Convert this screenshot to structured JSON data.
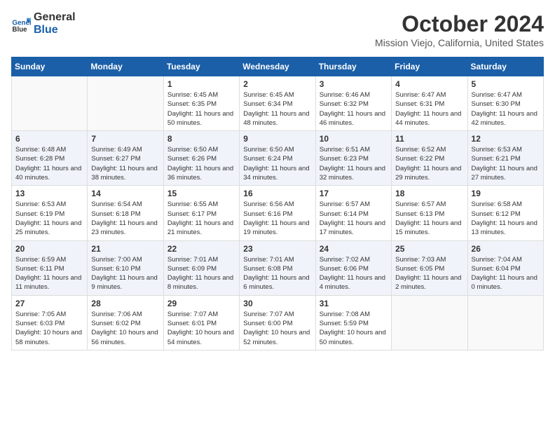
{
  "logo": {
    "line1": "General",
    "line2": "Blue"
  },
  "title": "October 2024",
  "location": "Mission Viejo, California, United States",
  "days_of_week": [
    "Sunday",
    "Monday",
    "Tuesday",
    "Wednesday",
    "Thursday",
    "Friday",
    "Saturday"
  ],
  "weeks": [
    [
      {
        "day": "",
        "content": ""
      },
      {
        "day": "",
        "content": ""
      },
      {
        "day": "1",
        "content": "Sunrise: 6:45 AM\nSunset: 6:35 PM\nDaylight: 11 hours and 50 minutes."
      },
      {
        "day": "2",
        "content": "Sunrise: 6:45 AM\nSunset: 6:34 PM\nDaylight: 11 hours and 48 minutes."
      },
      {
        "day": "3",
        "content": "Sunrise: 6:46 AM\nSunset: 6:32 PM\nDaylight: 11 hours and 46 minutes."
      },
      {
        "day": "4",
        "content": "Sunrise: 6:47 AM\nSunset: 6:31 PM\nDaylight: 11 hours and 44 minutes."
      },
      {
        "day": "5",
        "content": "Sunrise: 6:47 AM\nSunset: 6:30 PM\nDaylight: 11 hours and 42 minutes."
      }
    ],
    [
      {
        "day": "6",
        "content": "Sunrise: 6:48 AM\nSunset: 6:28 PM\nDaylight: 11 hours and 40 minutes."
      },
      {
        "day": "7",
        "content": "Sunrise: 6:49 AM\nSunset: 6:27 PM\nDaylight: 11 hours and 38 minutes."
      },
      {
        "day": "8",
        "content": "Sunrise: 6:50 AM\nSunset: 6:26 PM\nDaylight: 11 hours and 36 minutes."
      },
      {
        "day": "9",
        "content": "Sunrise: 6:50 AM\nSunset: 6:24 PM\nDaylight: 11 hours and 34 minutes."
      },
      {
        "day": "10",
        "content": "Sunrise: 6:51 AM\nSunset: 6:23 PM\nDaylight: 11 hours and 32 minutes."
      },
      {
        "day": "11",
        "content": "Sunrise: 6:52 AM\nSunset: 6:22 PM\nDaylight: 11 hours and 29 minutes."
      },
      {
        "day": "12",
        "content": "Sunrise: 6:53 AM\nSunset: 6:21 PM\nDaylight: 11 hours and 27 minutes."
      }
    ],
    [
      {
        "day": "13",
        "content": "Sunrise: 6:53 AM\nSunset: 6:19 PM\nDaylight: 11 hours and 25 minutes."
      },
      {
        "day": "14",
        "content": "Sunrise: 6:54 AM\nSunset: 6:18 PM\nDaylight: 11 hours and 23 minutes."
      },
      {
        "day": "15",
        "content": "Sunrise: 6:55 AM\nSunset: 6:17 PM\nDaylight: 11 hours and 21 minutes."
      },
      {
        "day": "16",
        "content": "Sunrise: 6:56 AM\nSunset: 6:16 PM\nDaylight: 11 hours and 19 minutes."
      },
      {
        "day": "17",
        "content": "Sunrise: 6:57 AM\nSunset: 6:14 PM\nDaylight: 11 hours and 17 minutes."
      },
      {
        "day": "18",
        "content": "Sunrise: 6:57 AM\nSunset: 6:13 PM\nDaylight: 11 hours and 15 minutes."
      },
      {
        "day": "19",
        "content": "Sunrise: 6:58 AM\nSunset: 6:12 PM\nDaylight: 11 hours and 13 minutes."
      }
    ],
    [
      {
        "day": "20",
        "content": "Sunrise: 6:59 AM\nSunset: 6:11 PM\nDaylight: 11 hours and 11 minutes."
      },
      {
        "day": "21",
        "content": "Sunrise: 7:00 AM\nSunset: 6:10 PM\nDaylight: 11 hours and 9 minutes."
      },
      {
        "day": "22",
        "content": "Sunrise: 7:01 AM\nSunset: 6:09 PM\nDaylight: 11 hours and 8 minutes."
      },
      {
        "day": "23",
        "content": "Sunrise: 7:01 AM\nSunset: 6:08 PM\nDaylight: 11 hours and 6 minutes."
      },
      {
        "day": "24",
        "content": "Sunrise: 7:02 AM\nSunset: 6:06 PM\nDaylight: 11 hours and 4 minutes."
      },
      {
        "day": "25",
        "content": "Sunrise: 7:03 AM\nSunset: 6:05 PM\nDaylight: 11 hours and 2 minutes."
      },
      {
        "day": "26",
        "content": "Sunrise: 7:04 AM\nSunset: 6:04 PM\nDaylight: 11 hours and 0 minutes."
      }
    ],
    [
      {
        "day": "27",
        "content": "Sunrise: 7:05 AM\nSunset: 6:03 PM\nDaylight: 10 hours and 58 minutes."
      },
      {
        "day": "28",
        "content": "Sunrise: 7:06 AM\nSunset: 6:02 PM\nDaylight: 10 hours and 56 minutes."
      },
      {
        "day": "29",
        "content": "Sunrise: 7:07 AM\nSunset: 6:01 PM\nDaylight: 10 hours and 54 minutes."
      },
      {
        "day": "30",
        "content": "Sunrise: 7:07 AM\nSunset: 6:00 PM\nDaylight: 10 hours and 52 minutes."
      },
      {
        "day": "31",
        "content": "Sunrise: 7:08 AM\nSunset: 5:59 PM\nDaylight: 10 hours and 50 minutes."
      },
      {
        "day": "",
        "content": ""
      },
      {
        "day": "",
        "content": ""
      }
    ]
  ]
}
